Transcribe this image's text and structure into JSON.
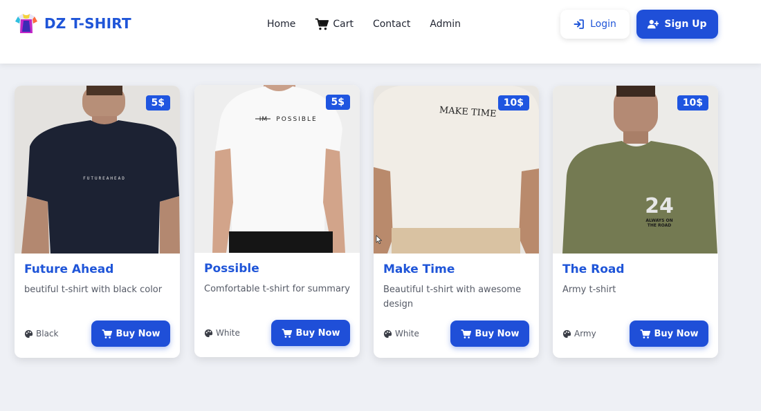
{
  "brand": {
    "name": "DZ T-SHIRT",
    "logo_icon": "tshirt-logo-icon"
  },
  "nav": {
    "home": "Home",
    "cart": "Cart",
    "contact": "Contact",
    "admin": "Admin"
  },
  "auth": {
    "login": "Login",
    "signup": "Sign Up"
  },
  "colors": {
    "accent": "#1f55d8",
    "button": "#1f4fd8",
    "badge": "#1f55e0",
    "background": "#eef0f5"
  },
  "products": [
    {
      "name": "Future Ahead",
      "description": "beutiful t-shirt with black color",
      "price": "5$",
      "color": "Black",
      "buy_label": "Buy Now",
      "shirt_print": "FUTUREAHEAD"
    },
    {
      "name": "Possible",
      "description": "Comfortable t-shirt for summary",
      "price": "5$",
      "color": "White",
      "buy_label": "Buy Now",
      "shirt_print_strike": "IM",
      "shirt_print": "POSSIBLE"
    },
    {
      "name": "Make Time",
      "description": "Beautiful t-shirt with awesome design",
      "price": "10$",
      "color": "White",
      "buy_label": "Buy Now",
      "shirt_print": "MAKE TIME"
    },
    {
      "name": "The Road",
      "description": "Army t-shirt",
      "price": "10$",
      "color": "Army",
      "buy_label": "Buy Now",
      "shirt_print": "24",
      "shirt_print_sub1": "ALWAYS ON",
      "shirt_print_sub2": "THE ROAD"
    }
  ]
}
